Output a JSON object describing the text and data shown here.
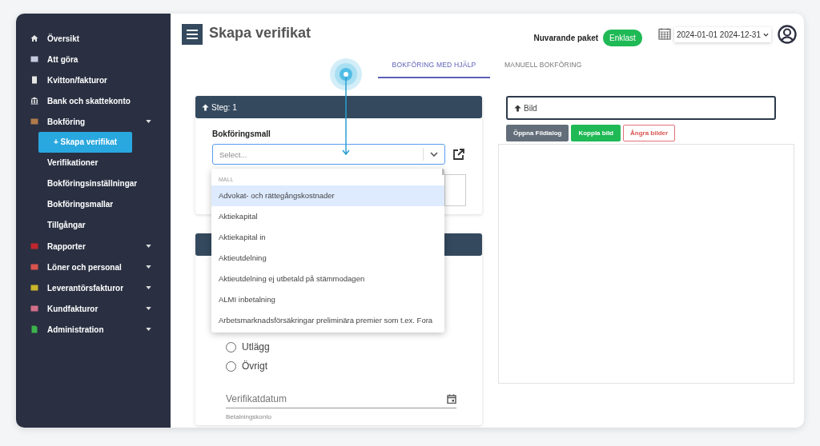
{
  "sidebar": {
    "items": [
      {
        "label": "Översikt",
        "kind": "home",
        "caret": false
      },
      {
        "label": "Att göra",
        "kind": "list",
        "caret": false
      },
      {
        "label": "Kvitton/fakturor",
        "kind": "receipt",
        "caret": false
      },
      {
        "label": "Bank och skattekonto",
        "kind": "bank",
        "caret": false
      },
      {
        "label": "Bokföring",
        "kind": "ledger",
        "caret": true,
        "children": [
          {
            "label": "+ Skapa verifikat",
            "selected": true
          },
          {
            "label": "Verifikationer",
            "selected": false
          },
          {
            "label": "Bokföringsinställningar",
            "selected": false
          },
          {
            "label": "Bokföringsmallar",
            "selected": false
          },
          {
            "label": "Tillgångar",
            "selected": false
          }
        ]
      },
      {
        "label": "Rapporter",
        "kind": "chart",
        "caret": true
      },
      {
        "label": "Löner och personal",
        "kind": "card",
        "caret": true
      },
      {
        "label": "Leverantörsfakturor",
        "kind": "money",
        "caret": true
      },
      {
        "label": "Kundfakturor",
        "kind": "invoice",
        "caret": true
      },
      {
        "label": "Administration",
        "kind": "file",
        "caret": true
      }
    ]
  },
  "header": {
    "title": "Skapa verifikat",
    "package_label": "Nuvarande paket",
    "package": "Enklast",
    "period": "2024-01-01 2024-12-31"
  },
  "tabs": [
    {
      "label": "BOKFÖRING MED HJÄLP",
      "selected": true
    },
    {
      "label": "MANUELL BOKFÖRING",
      "selected": false
    }
  ],
  "step1": {
    "title": "Steg: 1",
    "field_label": "Bokföringsmall",
    "placeholder": "Select..."
  },
  "dropdown": {
    "group": "MALL",
    "options": [
      {
        "label": "Advokat- och rättegångskostnader",
        "selected": true
      },
      {
        "label": "Aktiekapital",
        "selected": false
      },
      {
        "label": "Aktiekapital in",
        "selected": false
      },
      {
        "label": "Aktieutdelning",
        "selected": false
      },
      {
        "label": "Aktieutdelning ej utbetald på stämmodagen",
        "selected": false
      },
      {
        "label": "ALMI inbetalning",
        "selected": false
      },
      {
        "label": "Arbetsmarknadsförsäkringar preliminära premier som t.ex. Fora",
        "selected": false
      }
    ]
  },
  "step2": {
    "radios": [
      {
        "label": "Utlägg",
        "selected": false
      },
      {
        "label": "Övrigt",
        "selected": false
      }
    ],
    "date_placeholder": "Verifikatdatum",
    "account_label": "Betalningskonto"
  },
  "image_panel": {
    "title": "Bild",
    "buttons": [
      {
        "label": "Öppna Fildialog",
        "kind": "secondary"
      },
      {
        "label": "Koppla bild",
        "kind": "success"
      },
      {
        "label": "Ångra bilder",
        "kind": "danger"
      }
    ]
  }
}
